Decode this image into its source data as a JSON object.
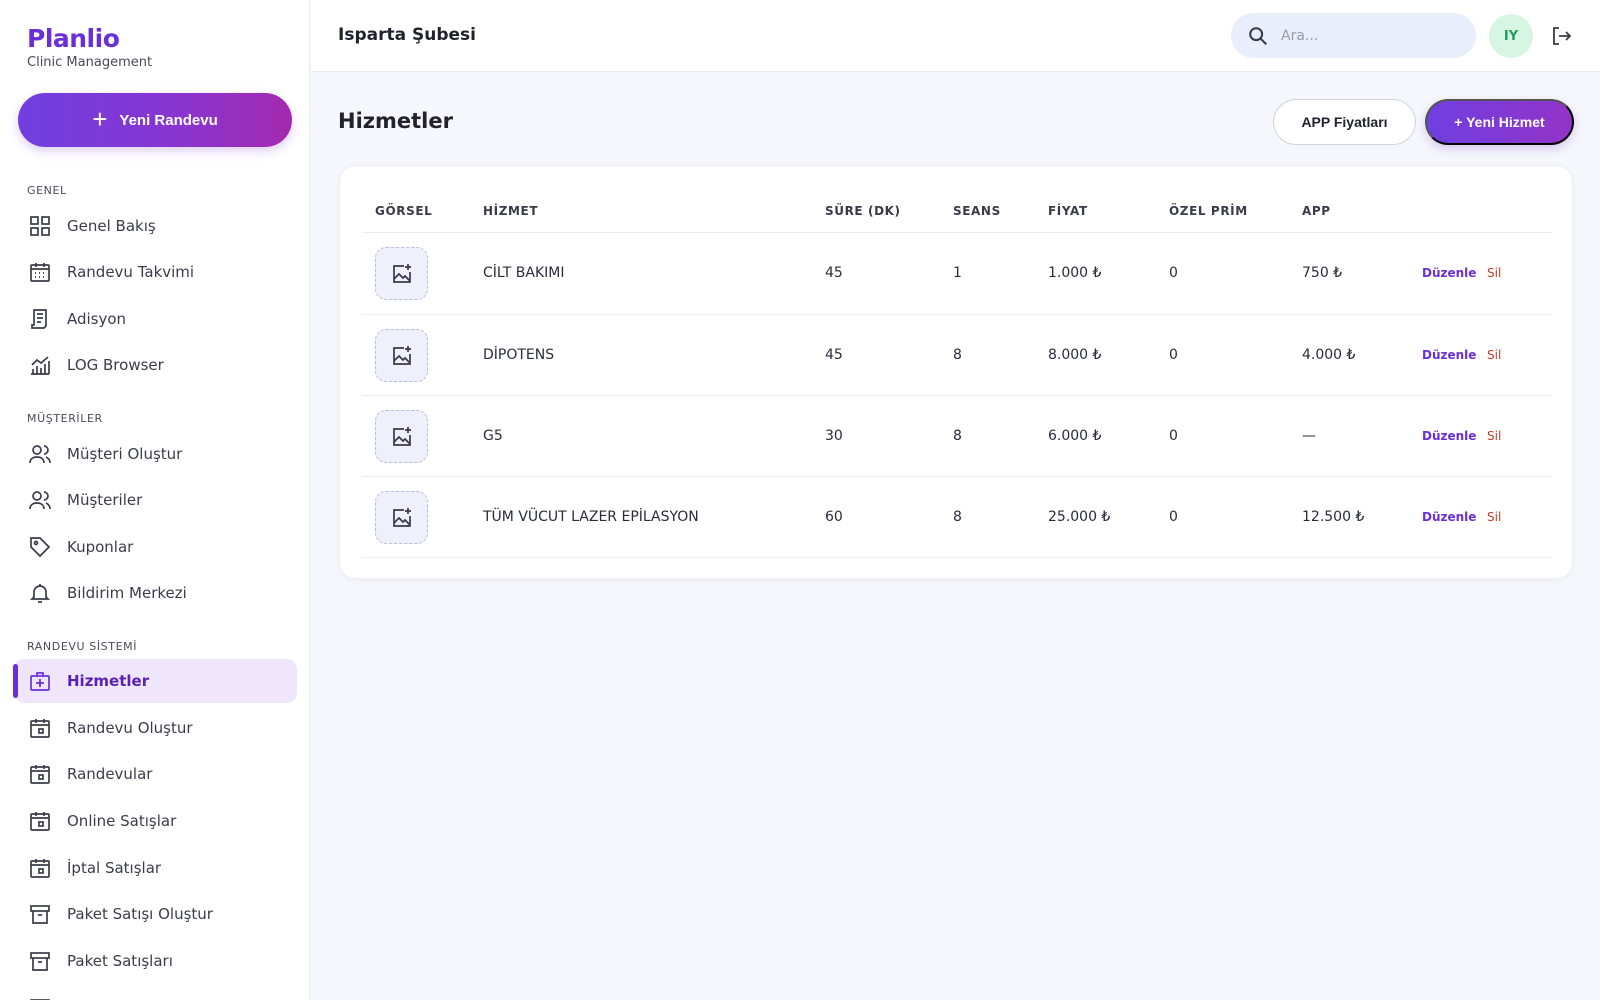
{
  "brand": {
    "name": "Planlio",
    "subtitle": "Clinic Management"
  },
  "sidebar": {
    "new_button": "Yeni Randevu",
    "sections": [
      {
        "label": "GENEL",
        "items": [
          "Genel Bakış",
          "Randevu Takvimi",
          "Adisyon",
          "LOG Browser"
        ]
      },
      {
        "label": "MÜŞTERİLER",
        "items": [
          "Müşteri Oluştur",
          "Müşteriler",
          "Kuponlar",
          "Bildirim Merkezi"
        ]
      },
      {
        "label": "RANDEVU SİSTEMİ",
        "items": [
          "Hizmetler",
          "Randevu Oluştur",
          "Randevular",
          "Online Satışlar",
          "İptal Satışlar",
          "Paket Satışı Oluştur",
          "Paket Satışları"
        ]
      }
    ],
    "active_item": "Hizmetler"
  },
  "header": {
    "branch": "Isparta Şubesi",
    "search_placeholder": "Ara...",
    "avatar_initials": "IY"
  },
  "main": {
    "title": "Hizmetler",
    "btn_app_prices": "APP Fiyatları",
    "btn_new_service": "+ Yeni Hizmet",
    "columns": [
      "GÖRSEL",
      "HİZMET",
      "SÜRE (DK)",
      "SEANS",
      "FİYAT",
      "ÖZEL PRİM",
      "APP"
    ],
    "rows": [
      {
        "name": "CİLT BAKIMI",
        "duration": "45",
        "sessions": "1",
        "price": "1.000 ₺",
        "bonus": "0",
        "app": "750 ₺"
      },
      {
        "name": "DİPOTENS",
        "duration": "45",
        "sessions": "8",
        "price": "8.000 ₺",
        "bonus": "0",
        "app": "4.000 ₺"
      },
      {
        "name": "G5",
        "duration": "30",
        "sessions": "8",
        "price": "6.000 ₺",
        "bonus": "0",
        "app": "—"
      },
      {
        "name": "TÜM VÜCUT LAZER EPİLASYON",
        "duration": "60",
        "sessions": "8",
        "price": "25.000 ₺",
        "bonus": "0",
        "app": "12.500 ₺"
      }
    ],
    "edit_label": "Düzenle",
    "delete_label": "Sil"
  }
}
